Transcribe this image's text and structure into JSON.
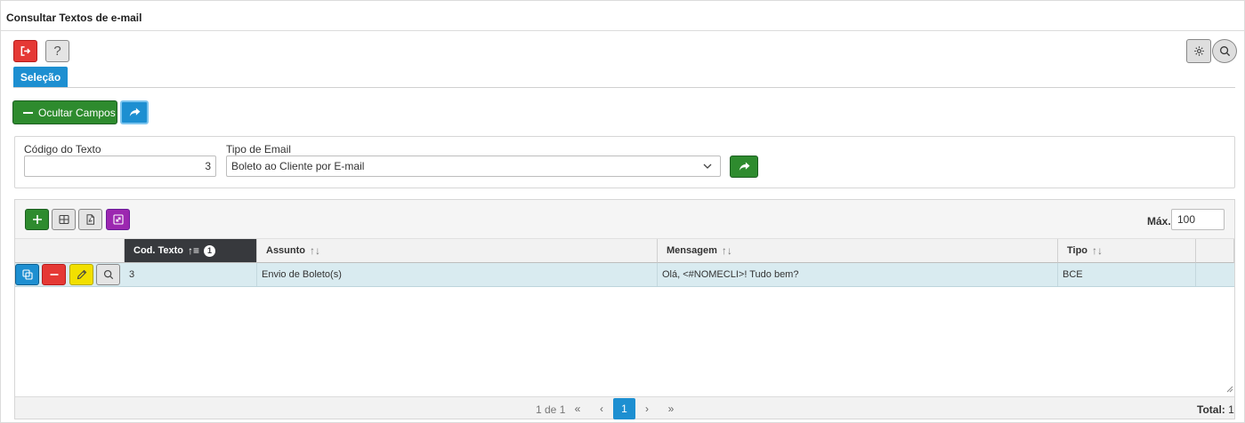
{
  "window": {
    "title": "Consultar Textos de e-mail"
  },
  "toolbar": {
    "exit_icon": "exit-icon",
    "help_label": "?",
    "settings_icon": "gear-icon",
    "search_icon": "search-icon"
  },
  "tabs": [
    {
      "label": "Seleção",
      "active": true
    }
  ],
  "actions": {
    "ocultar_label": "Ocultar Campos",
    "share_icon": "share-arrow-icon"
  },
  "filters": {
    "codigo": {
      "label": "Código do Texto",
      "value": "3"
    },
    "tipo": {
      "label": "Tipo de Email",
      "selected": "Boleto ao Cliente por E-mail"
    }
  },
  "grid": {
    "max_label": "Máx.",
    "max_value": "100",
    "sort_badge": "1",
    "columns": [
      {
        "label": "Cod. Texto",
        "sorted": "asc"
      },
      {
        "label": "Assunto"
      },
      {
        "label": "Mensagem"
      },
      {
        "label": "Tipo"
      }
    ],
    "rows": [
      {
        "cod": "3",
        "assunto": "Envio de Boleto(s)",
        "mensagem": "Olá, <#NOMECLI>! Tudo bem?",
        "tipo": "BCE"
      }
    ],
    "pagination": {
      "info": "1 de 1",
      "first": "«",
      "prev": "‹",
      "current": "1",
      "next": "›",
      "last": "»"
    },
    "total_label": "Total:",
    "total_value": "1"
  },
  "colors": {
    "primary": "#1d8fd1",
    "success": "#2e8b2e",
    "danger": "#e53935",
    "warning": "#f2e000",
    "purple": "#9c27b0",
    "header_dark": "#37393d",
    "row_highlight": "#d9ebf0"
  }
}
